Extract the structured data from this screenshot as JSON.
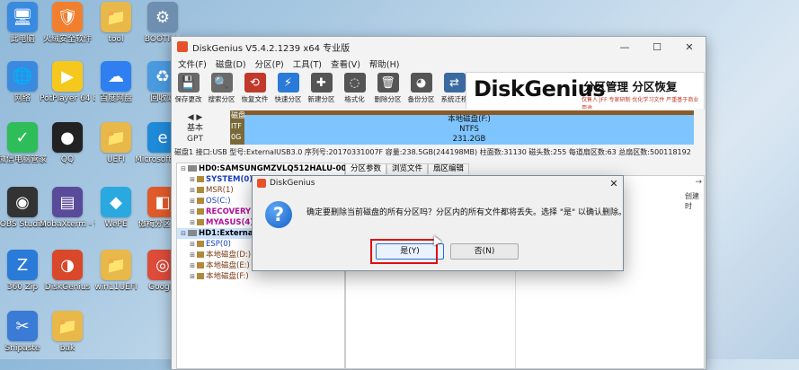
{
  "colors": {
    "accent": "#1a3fbf",
    "highlight": "#e01010",
    "partition_fill": "#7ec4ff"
  },
  "desktop": {
    "icons": [
      {
        "label": "此电脑",
        "icon": "computer-icon",
        "color": "#3a8be0"
      },
      {
        "label": "火绒安全软件",
        "icon": "fire-shield-icon",
        "color": "#f08030"
      },
      {
        "label": "tool",
        "icon": "folder-icon",
        "color": "#e8b84a"
      },
      {
        "label": "BOOTICE",
        "icon": "bootice-icon",
        "color": "#6e8fb0"
      },
      {
        "label": "网络",
        "icon": "network-icon",
        "color": "#3a8be0"
      },
      {
        "label": "PotPlayer 64 bit",
        "icon": "play-icon",
        "color": "#f6c81e"
      },
      {
        "label": "百度网盘",
        "icon": "cloud-icon",
        "color": "#2f7ff0"
      },
      {
        "label": "回收站",
        "icon": "recycle-bin-icon",
        "color": "#4a9ae0"
      },
      {
        "label": "微信电脑管家",
        "icon": "bag-icon",
        "color": "#2ebd59"
      },
      {
        "label": "QQ",
        "icon": "penguin-icon",
        "color": "#222222"
      },
      {
        "label": "UEFI",
        "icon": "folder-icon",
        "color": "#e8b84a"
      },
      {
        "label": "Microsoft Edge",
        "icon": "edge-icon",
        "color": "#1f8ad8"
      },
      {
        "label": "OBS Studio",
        "icon": "obs-icon",
        "color": "#333333"
      },
      {
        "label": "MobaXterm - 快捷方式",
        "icon": "terminal-icon",
        "color": "#5a4a9a"
      },
      {
        "label": "WePE",
        "icon": "wepe-icon",
        "color": "#2aa9e0"
      },
      {
        "label": "傲梅分区助手",
        "icon": "partition-icon",
        "color": "#e05a2a"
      },
      {
        "label": "360 Zip",
        "icon": "zip-icon",
        "color": "#2a7ad8"
      },
      {
        "label": "DiskGenius",
        "icon": "diskgenius-icon",
        "color": "#d9482b"
      },
      {
        "label": "win11UEFI",
        "icon": "folder-icon",
        "color": "#e8b84a"
      },
      {
        "label": "Google",
        "icon": "chrome-icon",
        "color": "#dd4b39"
      },
      {
        "label": "Snipaste",
        "icon": "snipaste-icon",
        "color": "#3a7bd5"
      },
      {
        "label": "bak",
        "icon": "folder-icon",
        "color": "#e8b84a"
      }
    ]
  },
  "window": {
    "title": "DiskGenius V5.4.2.1239 x64 专业版",
    "menu": [
      "文件(F)",
      "磁盘(D)",
      "分区(P)",
      "工具(T)",
      "查看(V)",
      "帮助(H)"
    ],
    "toolbar": [
      {
        "label": "保存更改",
        "icon": "save-icon",
        "color": "#6a6a6a"
      },
      {
        "label": "搜索分区",
        "icon": "search-icon",
        "color": "#6a6a6a"
      },
      {
        "label": "恢复文件",
        "icon": "recover-icon",
        "color": "#c0392b"
      },
      {
        "label": "快速分区",
        "icon": "quick-partition-icon",
        "color": "#2a7ad8"
      },
      {
        "label": "新建分区",
        "icon": "new-partition-icon",
        "color": "#555555"
      },
      {
        "label": "格式化",
        "icon": "format-icon",
        "color": "#555555"
      },
      {
        "label": "删除分区",
        "icon": "delete-icon",
        "color": "#555555"
      },
      {
        "label": "备份分区",
        "icon": "backup-icon",
        "color": "#555555"
      },
      {
        "label": "系统迁移",
        "icon": "migrate-icon",
        "color": "#3a6aa0"
      }
    ],
    "banner": {
      "logo": "DiskGenius",
      "slogan": "分区管理 分区恢复",
      "subslogan": "仅售人 JFF 专家研制  优化学习文件 严重基于商业用途"
    },
    "disk_map": {
      "nav_label": "基本\nGPT",
      "small_seg": "磁盘\nITF\n0G",
      "partition_name": "本地磁盘(F:)",
      "partition_fs": "NTFS",
      "partition_size": "231.2GB"
    },
    "disk_info": "磁盘1 接口:USB 型号:ExternalUSB3.0 序列号:20170331007F 容量:238.5GB(244198MB) 柱面数:31130 磁头数:255 每道扇区数:63 总扇区数:500118192",
    "tree": {
      "disk0": "HD0:SAMSUNGMZVLQ512HALU-000",
      "disk0_parts": [
        {
          "label": "SYSTEM(0)",
          "cls": "blue bold"
        },
        {
          "label": "MSR(1)",
          "cls": "darkred"
        },
        {
          "label": "OS(C:)",
          "cls": "blue"
        },
        {
          "label": "RECOVERY(3)",
          "cls": "magenta bold"
        },
        {
          "label": "MYASUS(4)",
          "cls": "magenta bold"
        }
      ],
      "disk1": "HD1:ExternalU",
      "disk1_parts": [
        {
          "label": "ESP(0)",
          "cls": "blue"
        },
        {
          "label": "本地磁盘(D:)",
          "cls": "darkred"
        },
        {
          "label": "本地磁盘(E:)",
          "cls": "darkred"
        },
        {
          "label": "本地磁盘(F:)",
          "cls": "darkred"
        }
      ]
    },
    "tabs": [
      "分区参数",
      "浏览文件",
      "扇区编辑"
    ],
    "right_column": "创建时"
  },
  "dialog": {
    "title": "DiskGenius",
    "message": "确定要删除当前磁盘的所有分区吗？分区内的所有文件都将丢失。选择 \"是\" 以确认删除。",
    "yes_label": "是(Y)",
    "no_label": "否(N)"
  }
}
